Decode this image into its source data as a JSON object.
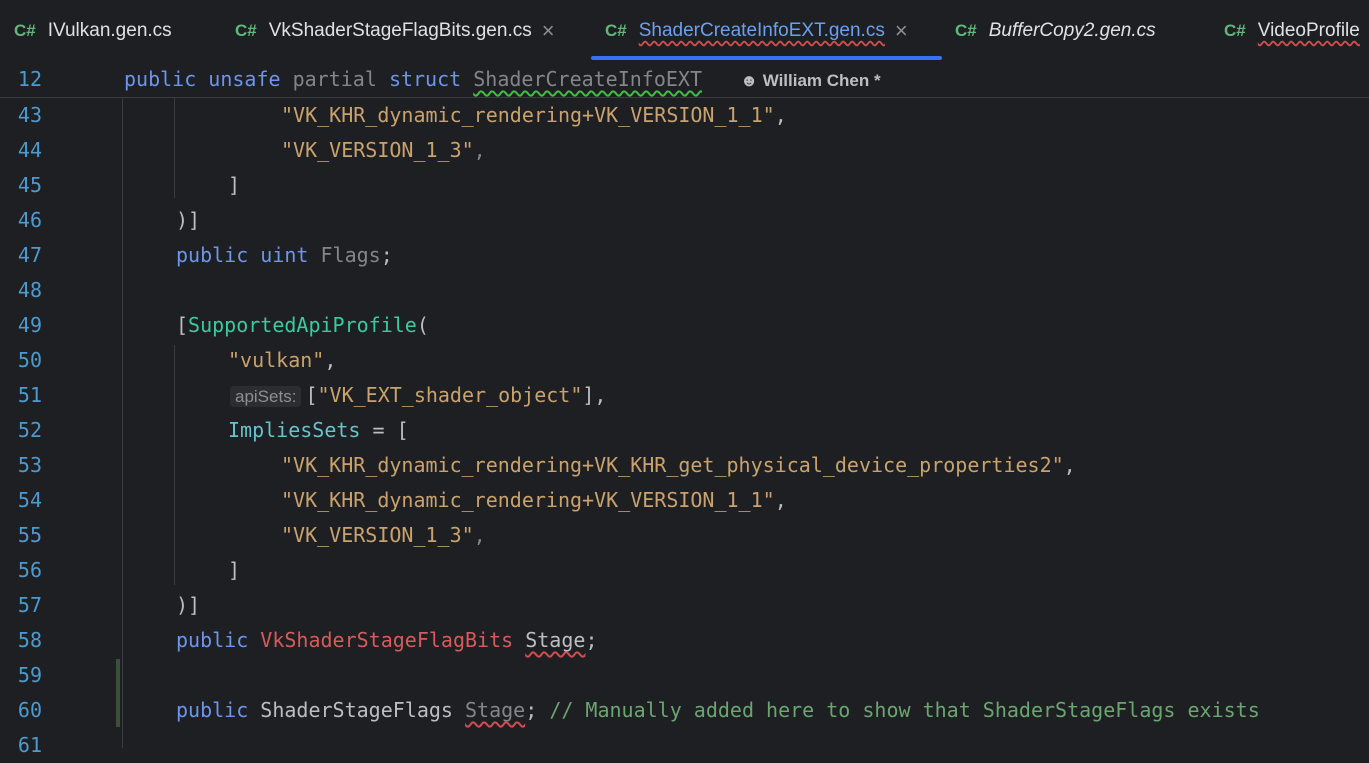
{
  "tabs": [
    {
      "lang": "C#",
      "name": "IVulkan.gen.cs"
    },
    {
      "lang": "C#",
      "name": "VkShaderStageFlagBits.gen.cs",
      "close": "×"
    },
    {
      "lang": "C#",
      "name": "ShaderCreateInfoEXT.gen.cs",
      "close": "×"
    },
    {
      "lang": "C#",
      "name": "BufferCopy2.gen.cs"
    },
    {
      "lang": "C#",
      "name": "VideoProfile"
    }
  ],
  "sticky": {
    "num": "12",
    "kw_public": "public",
    "kw_unsafe": "unsafe",
    "kw_partial": "partial",
    "kw_struct": "struct",
    "type_name": "ShaderCreateInfoEXT",
    "author": "William Chen *"
  },
  "code": {
    "s43": "\"VK_KHR_dynamic_rendering+VK_VERSION_1_1\"",
    "s44": "\"VK_VERSION_1_3\"",
    "close_bracket": "]",
    "close_attr": ")]",
    "kw_public": "public",
    "kw_uint": "uint",
    "field_flags": "Flags",
    "semicolon": ";",
    "comma": ",",
    "open_bracket": "[",
    "attr_name": "SupportedApiProfile",
    "open_paren": "(",
    "s50": "\"vulkan\"",
    "hint_apisets": "apiSets:",
    "s51": "\"VK_EXT_shader_object\"",
    "s51_tail": "],",
    "implies": "ImpliesSets",
    "assign": " = [",
    "s53": "\"VK_KHR_dynamic_rendering+VK_KHR_get_physical_device_properties2\"",
    "s54": "\"VK_KHR_dynamic_rendering+VK_VERSION_1_1\"",
    "s55": "\"VK_VERSION_1_3\"",
    "type_bits": "VkShaderStageFlagBits",
    "field_stage": "Stage",
    "type_flags": "ShaderStageFlags",
    "comment": "// Manually added here to show that ShaderStageFlags exists"
  },
  "line_numbers": [
    "43",
    "44",
    "45",
    "46",
    "47",
    "48",
    "49",
    "50",
    "51",
    "52",
    "53",
    "54",
    "55",
    "56",
    "57",
    "58",
    "59",
    "60",
    "61"
  ]
}
